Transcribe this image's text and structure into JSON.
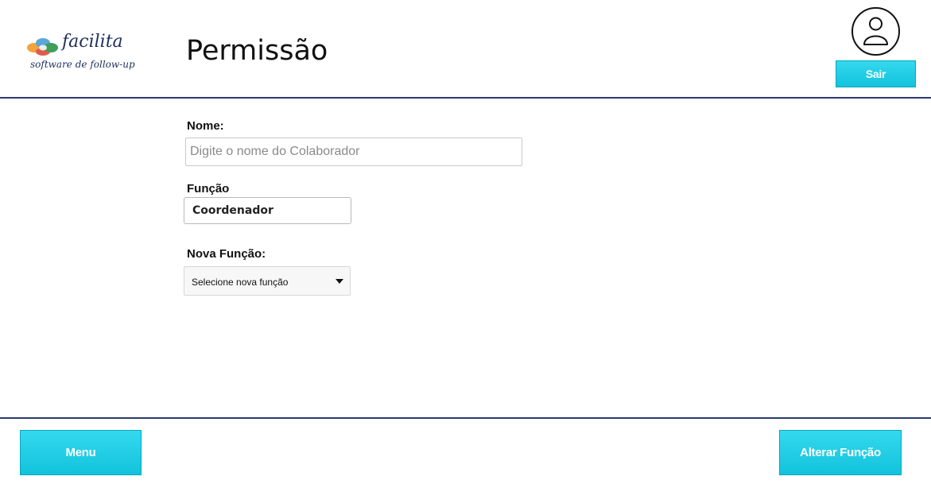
{
  "brand": {
    "name": "facilita",
    "tagline": "software de follow-up"
  },
  "page": {
    "title": "Permissão"
  },
  "header": {
    "user_icon": "user-icon",
    "logout_label": "Sair"
  },
  "form": {
    "nome": {
      "label": "Nome:",
      "value": "",
      "placeholder": "Digite o nome do Colaborador"
    },
    "funcao": {
      "label": "Função",
      "value": "Coordenador"
    },
    "nova_funcao": {
      "label": "Nova Função:",
      "selected": "Selecione nova função",
      "icon": "caret-down-icon"
    }
  },
  "footer": {
    "menu_label": "Menu",
    "submit_label": "Alterar Função"
  },
  "colors": {
    "accent": "#1fcbe2",
    "divider": "#2b3a6b",
    "brand_text": "#1f2f5c"
  }
}
